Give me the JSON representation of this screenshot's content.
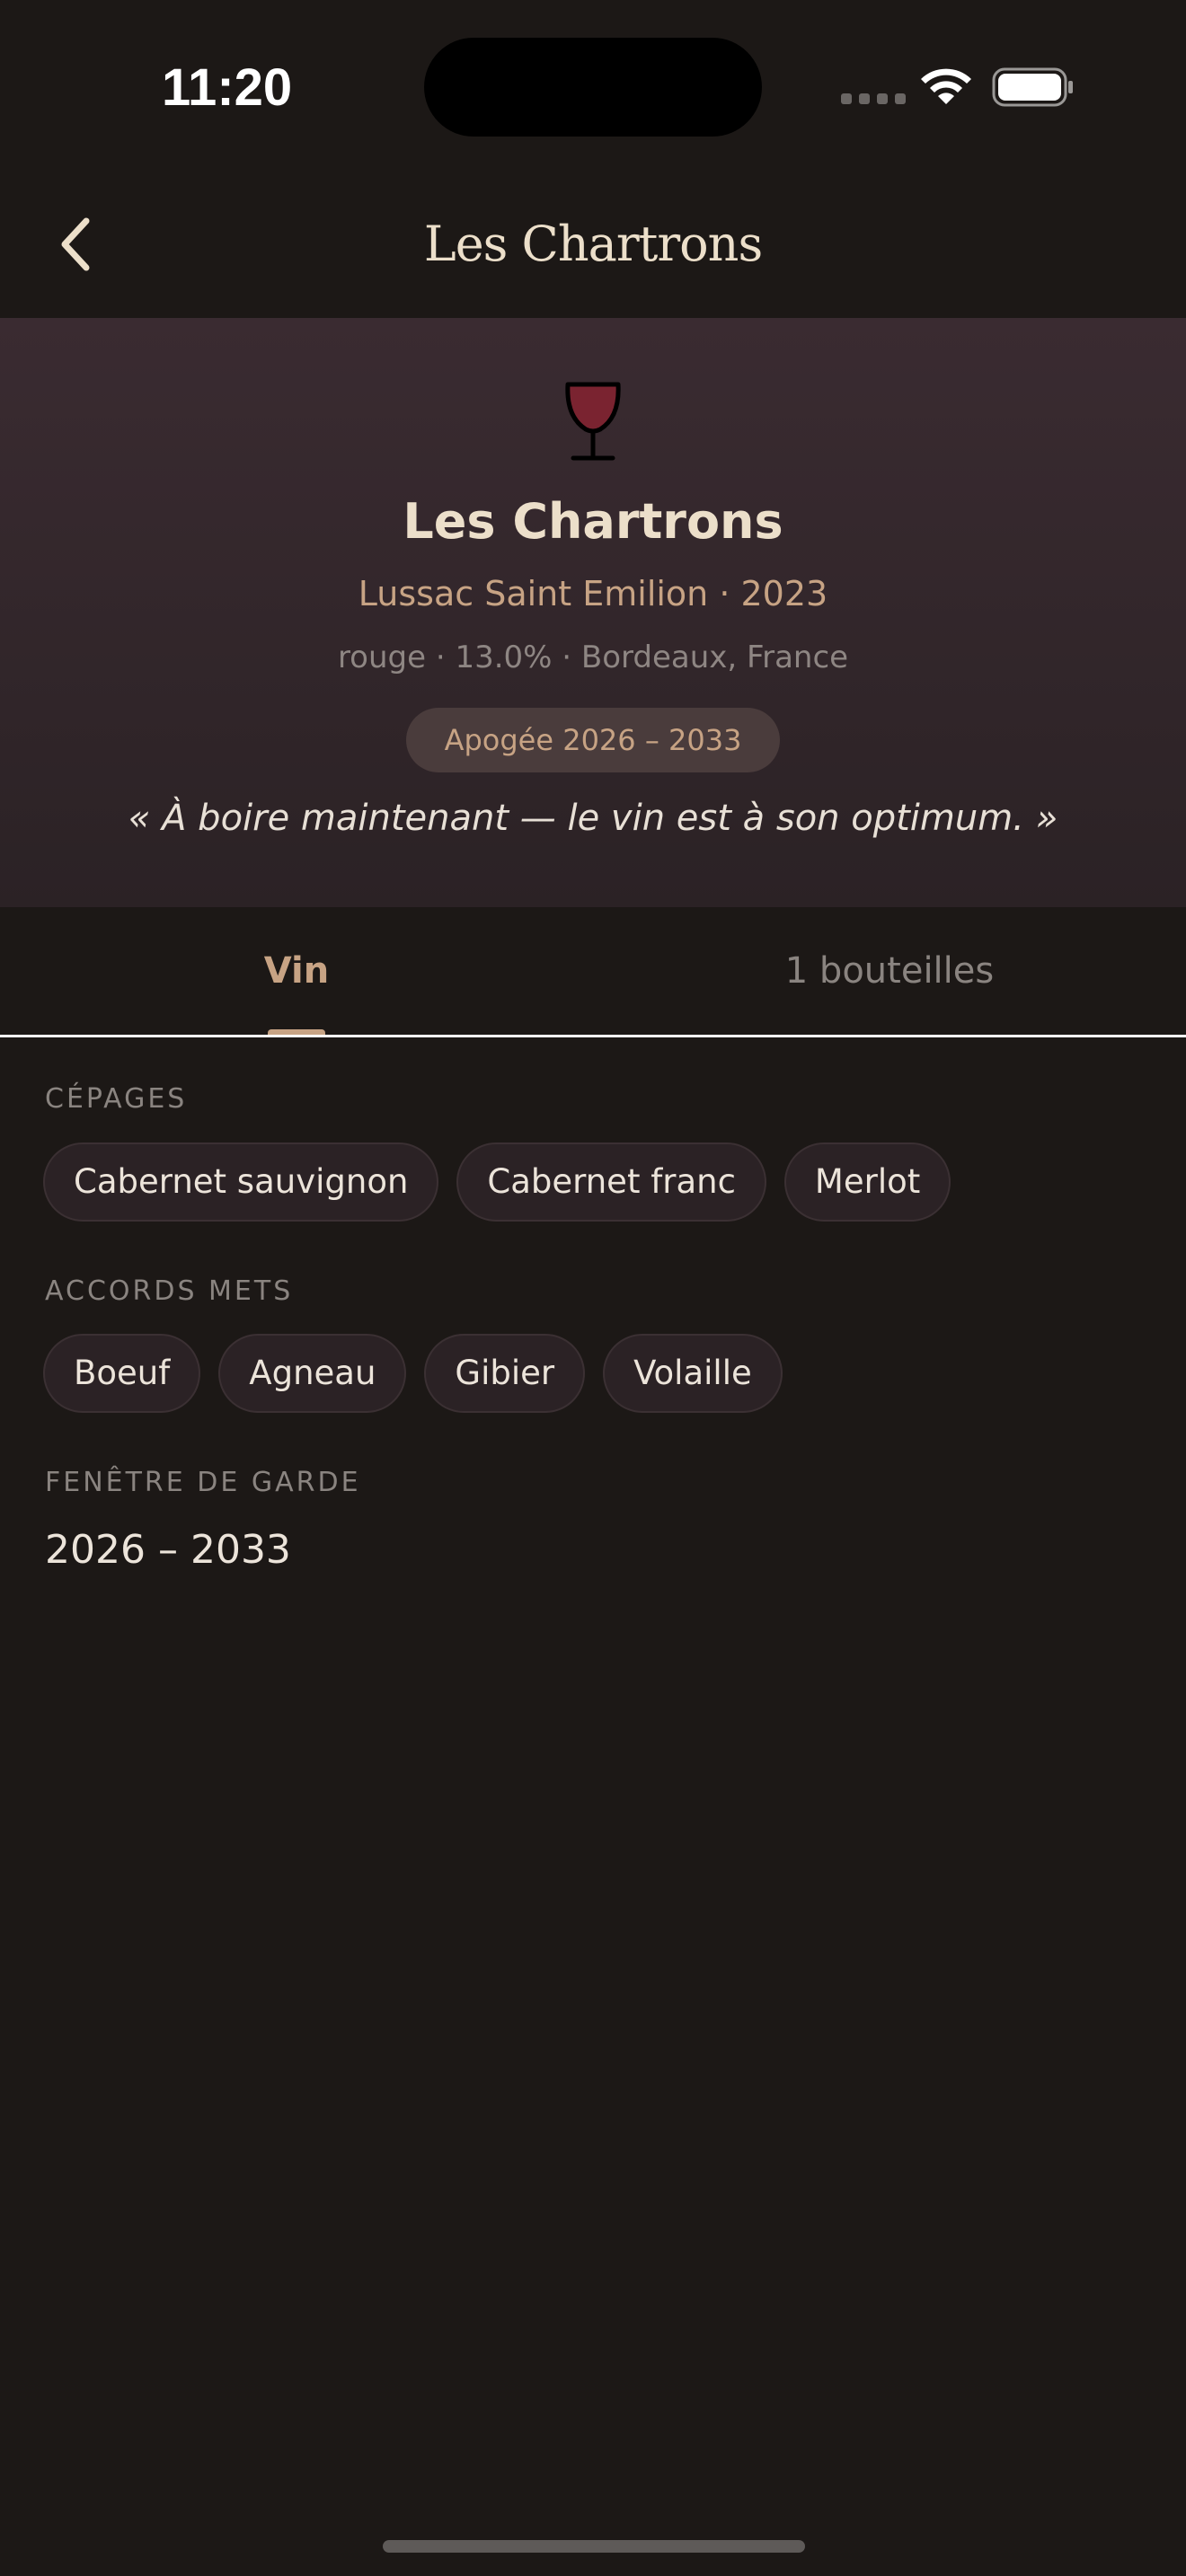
{
  "status_bar": {
    "time": "11:20"
  },
  "nav": {
    "title": "Les Chartrons",
    "back_icon": "chevron-left-icon"
  },
  "wine": {
    "name": "Les Chartrons",
    "subtitle": "Lussac Saint Emilion · 2023",
    "meta": "rouge · 13.0% · Bordeaux, France",
    "apogee": "Apogée 2026 – 2033",
    "quote": "« À boire maintenant — le vin est à son optimum. »",
    "icon": "wine-glass-icon",
    "glass_color": "#7a2330"
  },
  "tabs": [
    {
      "label": "Vin",
      "active": true
    },
    {
      "label": "1 bouteilles",
      "active": false
    }
  ],
  "cepages": {
    "label": "CÉPAGES",
    "items": [
      "Cabernet sauvignon",
      "Cabernet franc",
      "Merlot"
    ]
  },
  "accords": {
    "label": "ACCORDS METS",
    "items": [
      "Boeuf",
      "Agneau",
      "Gibier",
      "Volaille"
    ]
  },
  "garde": {
    "label": "FENÊTRE DE GARDE",
    "value": "2026 – 2033"
  },
  "colors": {
    "accent": "#c7a384",
    "background": "#1c1816",
    "hero": "#3a2b31"
  }
}
